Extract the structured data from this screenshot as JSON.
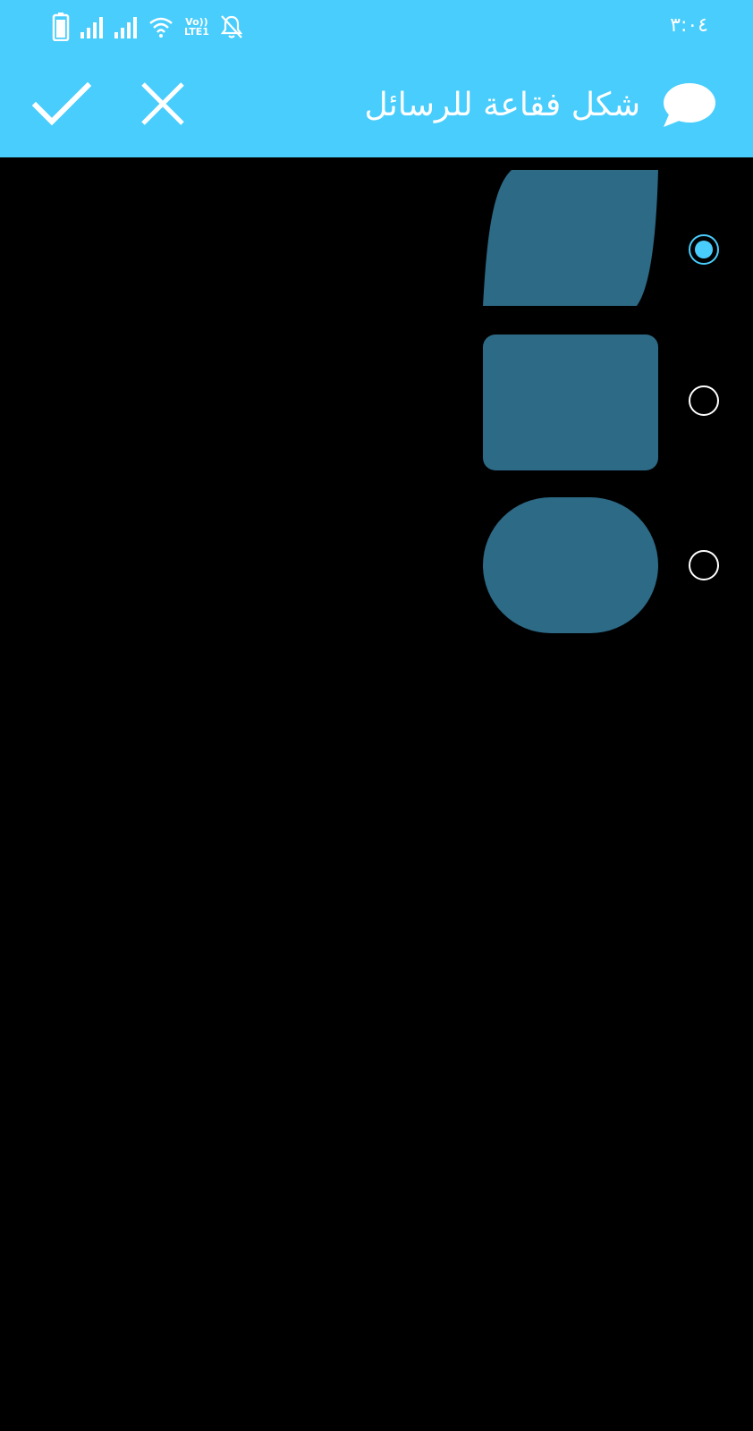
{
  "status_bar": {
    "time": "٣:٠٤",
    "volte_top": "Vo))",
    "volte_bottom": "LTE1",
    "icons": [
      "battery-icon",
      "signal-icon",
      "signal-icon",
      "wifi-icon",
      "volte-icon",
      "notifications-off-icon"
    ]
  },
  "action_bar": {
    "title": "شكل فقاعة للرسائل",
    "title_icon": "chat-bubble-icon",
    "confirm_icon": "check-icon",
    "cancel_icon": "close-icon"
  },
  "options": [
    {
      "shape": "slanted",
      "selected": true
    },
    {
      "shape": "rounded-rectangle",
      "selected": false
    },
    {
      "shape": "pill",
      "selected": false
    }
  ],
  "colors": {
    "accent": "#48CDFD",
    "background": "#000000",
    "bubble": "#2C6A86",
    "text": "#FFFFFF"
  }
}
